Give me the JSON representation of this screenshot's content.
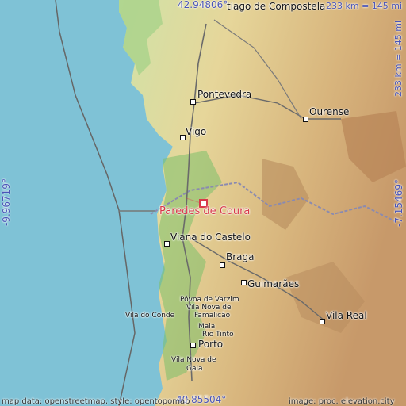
{
  "map": {
    "coords": {
      "top": "42.94806°",
      "bottom": "40.85504°",
      "left": "-9.96719°",
      "right": "-7.15469°"
    },
    "scale_top": "233 km = 145 mi",
    "scale_right": "233 km = 145 mi",
    "focus_place": "Paredes de Coura",
    "places": {
      "santiago": "tiago de Compostela",
      "pontevedra": "Pontevedra",
      "ourense": "Ourense",
      "vigo": "Vigo",
      "viana": "Viana do Castelo",
      "braga": "Braga",
      "guimaraes": "Guimarães",
      "povoa": "Póvoa de Varzim",
      "famalicao_1": "Vila Nova de",
      "famalicao_2": "Famalicão",
      "vila_conde": "Vila do Conde",
      "maia": "Maia",
      "rio_tinto": "Rio Tinto",
      "porto": "Porto",
      "gaia_1": "Vila Nova de",
      "gaia_2": "Gaia",
      "vila_real": "Vila Real"
    },
    "attribution_left": "map data: openstreetmap, style: opentopomap",
    "attribution_right": "image: proc. elevation.city",
    "colors": {
      "sea": "#7fc2d6",
      "land_low": "#cfe3a8",
      "land_mid": "#e6d69a",
      "land_high": "#c79a6a",
      "forest": "#7cbf6a",
      "focus": "#d8394a",
      "coord": "#4a55b8"
    }
  }
}
